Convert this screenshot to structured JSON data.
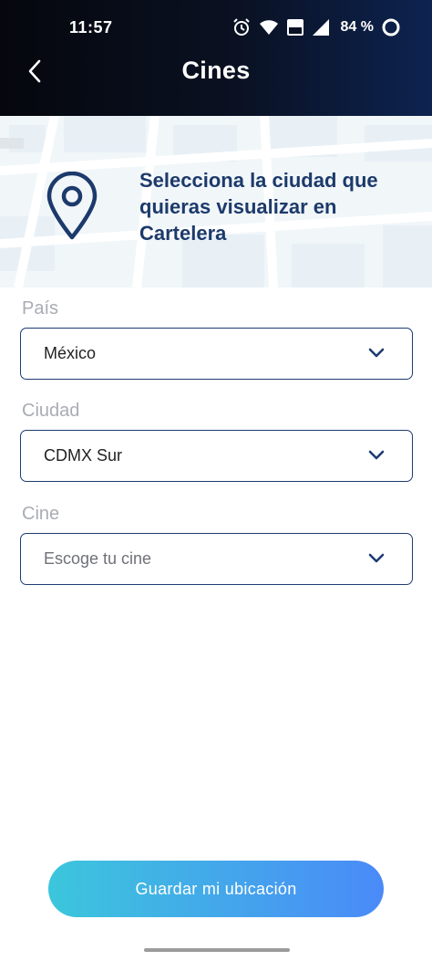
{
  "status_bar": {
    "time": "11:57",
    "battery": "84 %",
    "icons": [
      "alarm-icon",
      "wifi-icon",
      "volte-icon",
      "signal-icon",
      "battery-ring-icon"
    ]
  },
  "header": {
    "title": "Cines",
    "back_icon": "chevron-left-icon"
  },
  "banner": {
    "icon": "location-pin-icon",
    "text": "Selecciona la ciudad que quieras visualizar en Cartelera"
  },
  "form": {
    "country": {
      "label": "País",
      "value": "México"
    },
    "city": {
      "label": "Ciudad",
      "value": "CDMX Sur"
    },
    "cinema": {
      "label": "Cine",
      "placeholder": "Escoge tu cine"
    }
  },
  "save_button": {
    "label": "Guardar mi ubicación"
  },
  "colors": {
    "header_start": "#05070d",
    "header_end": "#0d2350",
    "accent_navy": "#1e3b73",
    "button_start": "#3cc6dc",
    "button_end": "#4a8af8"
  }
}
